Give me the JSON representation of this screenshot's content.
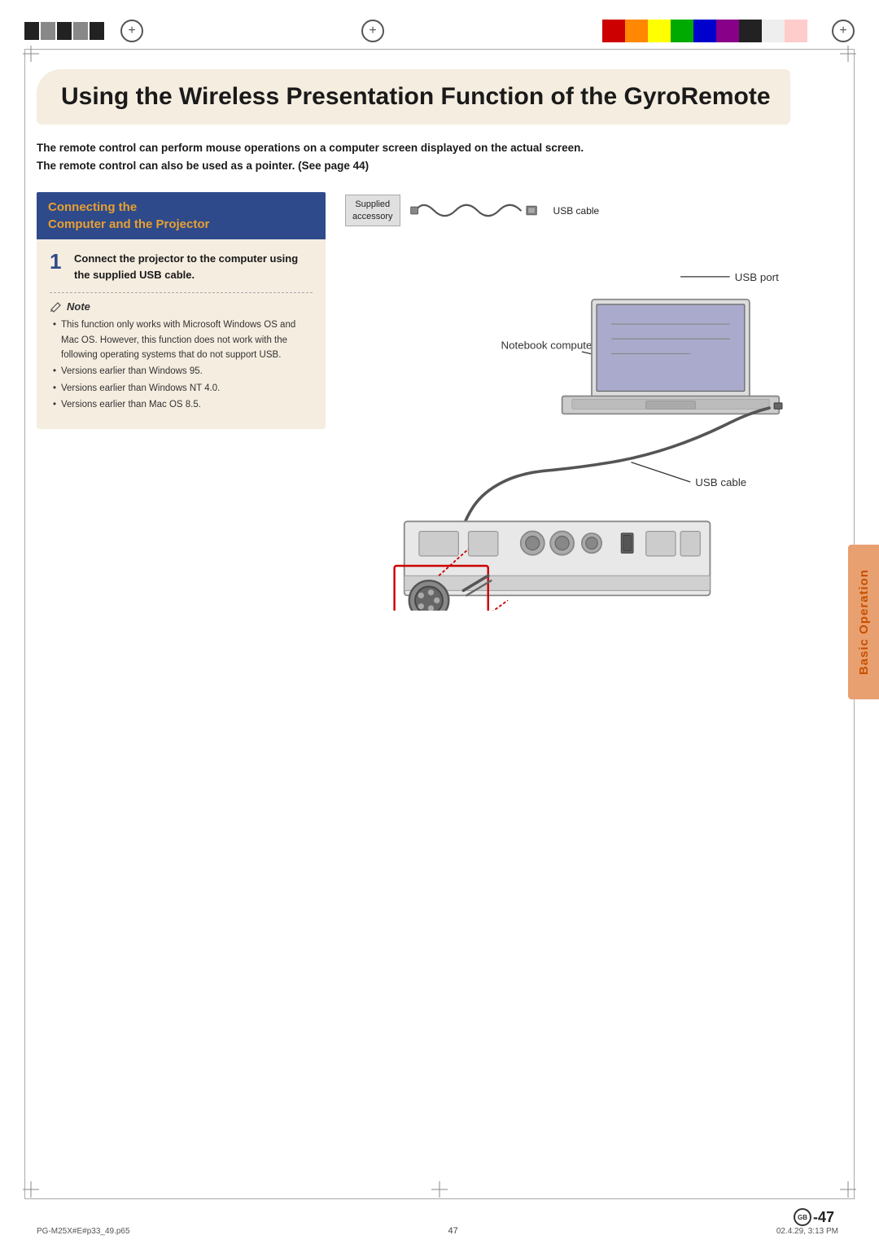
{
  "page": {
    "title": "Using the Wireless Presentation Function of the GyroRemote",
    "intro_text": "The remote control can perform mouse operations on a computer screen displayed on the actual screen. The remote control can also be used as a pointer. (See page 44)",
    "section_header_line1": "Connecting the",
    "section_header_line2": "Computer and the Projector",
    "step1_number": "1",
    "step1_text": "Connect the projector to the computer using the supplied USB cable.",
    "note_label": "Note",
    "note_items": [
      "This function only works with Microsoft Windows OS and Mac OS. However, this function does not work with the following operating systems that do not support USB.",
      "Versions earlier than Windows 95.",
      "Versions earlier than Windows NT 4.0.",
      "Versions earlier than Mac OS 8.5."
    ],
    "accessory_label_line1": "Supplied",
    "accessory_label_line2": "accessory",
    "usb_cable_label": "USB cable",
    "usb_port_label": "USB port",
    "notebook_label": "Notebook computer",
    "usb_cable_label2": "USB cable",
    "side_tab_text": "Basic Operation",
    "footer_left": "PG-M25X#E#p33_49.p65",
    "footer_center": "47",
    "footer_right": "02.4.29, 3:13 PM",
    "page_badge": "GB",
    "page_number": "-47"
  },
  "colors": {
    "section_header_bg": "#2e4a8a",
    "section_header_orange": "#e8a030",
    "content_bg": "#f5ede0",
    "side_tab_bg": "#e8a070",
    "side_tab_text": "#c85000"
  }
}
